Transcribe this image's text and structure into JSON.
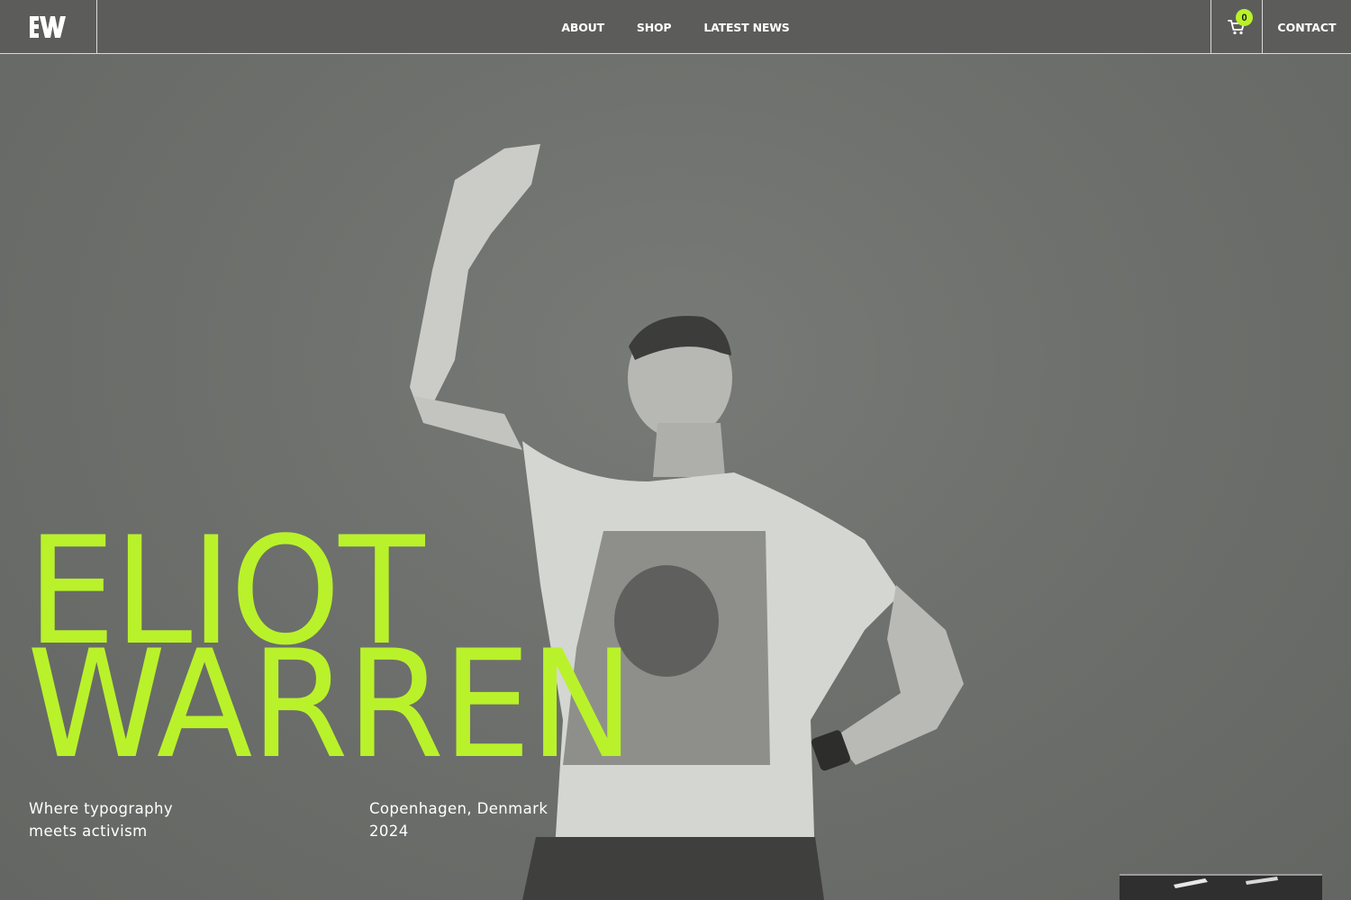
{
  "header": {
    "logo_alt": "EW",
    "nav": [
      {
        "label": "About"
      },
      {
        "label": "Shop"
      },
      {
        "label": "Latest News"
      }
    ],
    "cart_count": "0",
    "contact_label": "CONTACT"
  },
  "hero": {
    "title_line1": "ELIOT",
    "title_line2": "WARREN",
    "tagline_line1": "Where typography",
    "tagline_line2": "meets activism",
    "location_line1": "Copenhagen, Denmark",
    "location_line2": "2024",
    "accent_color": "#b9f22a"
  },
  "icons": {
    "logo": "ew-monogram-logo",
    "cart": "shopping-cart-icon"
  }
}
